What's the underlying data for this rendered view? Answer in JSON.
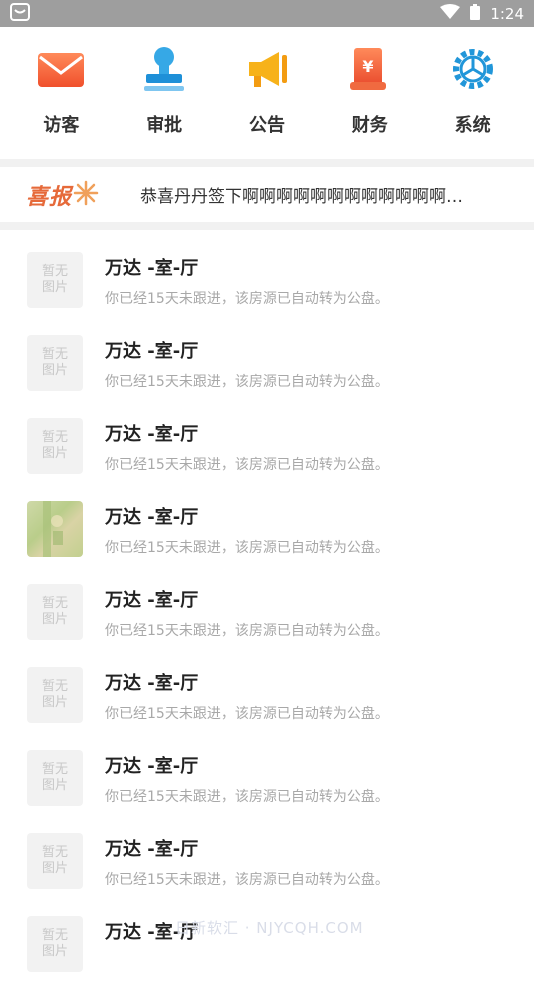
{
  "status_bar": {
    "time": "1:24"
  },
  "nav": [
    {
      "label": "访客",
      "icon": "mail-icon"
    },
    {
      "label": "审批",
      "icon": "stamp-icon"
    },
    {
      "label": "公告",
      "icon": "megaphone-icon"
    },
    {
      "label": "财务",
      "icon": "yuan-receipt-icon"
    },
    {
      "label": "系统",
      "icon": "gear-icon"
    }
  ],
  "news": {
    "title": "喜报",
    "text": "恭喜丹丹签下啊啊啊啊啊啊啊啊啊啊啊啊…"
  },
  "listings": [
    {
      "title": "万达 -室-厅",
      "subtitle": "你已经15天未跟进，该房源已自动转为公盘。",
      "thumb": "暂无图片"
    },
    {
      "title": "万达 -室-厅",
      "subtitle": "你已经15天未跟进，该房源已自动转为公盘。",
      "thumb": "暂无图片"
    },
    {
      "title": "万达 -室-厅",
      "subtitle": "你已经15天未跟进，该房源已自动转为公盘。",
      "thumb": "暂无图片"
    },
    {
      "title": "万达 -室-厅",
      "subtitle": "你已经15天未跟进，该房源已自动转为公盘。",
      "thumb": "photo"
    },
    {
      "title": "万达 -室-厅",
      "subtitle": "你已经15天未跟进，该房源已自动转为公盘。",
      "thumb": "暂无图片"
    },
    {
      "title": "万达 -室-厅",
      "subtitle": "你已经15天未跟进，该房源已自动转为公盘。",
      "thumb": "暂无图片"
    },
    {
      "title": "万达 -室-厅",
      "subtitle": "你已经15天未跟进，该房源已自动转为公盘。",
      "thumb": "暂无图片"
    },
    {
      "title": "万达 -室-厅",
      "subtitle": "你已经15天未跟进，该房源已自动转为公盘。",
      "thumb": "暂无图片"
    },
    {
      "title": "万达 -室-厅",
      "subtitle": "",
      "thumb": "暂无图片"
    }
  ],
  "thumb_placeholder": {
    "line1": "暂无",
    "line2": "图片"
  },
  "watermark": "日新软汇 · NJYCQH.COM",
  "colors": {
    "accent": "#e66a3a",
    "status_bar": "#9e9e9e",
    "divider": "#f1f1f1"
  }
}
